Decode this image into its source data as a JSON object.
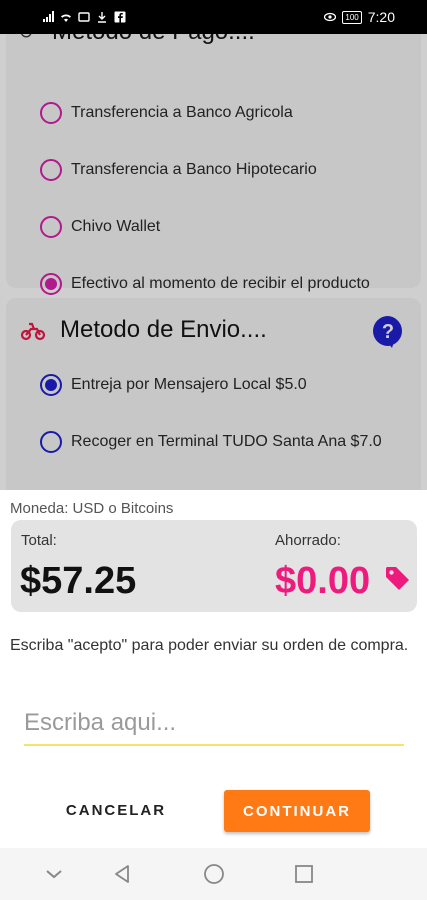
{
  "status_bar": {
    "battery": "100",
    "time": "7:20"
  },
  "payment_card": {
    "title": "Metodo de Pago....",
    "options": [
      {
        "label": "Transferencia a Banco Agricola",
        "selected": false
      },
      {
        "label": "Transferencia a Banco Hipotecario",
        "selected": false
      },
      {
        "label": "Chivo Wallet",
        "selected": false
      },
      {
        "label": "Efectivo al momento de recibir el producto",
        "selected": true
      }
    ]
  },
  "shipping_card": {
    "title": "Metodo de Envio....",
    "options": [
      {
        "label": "Entreja por Mensajero Local $5.0",
        "selected": true
      },
      {
        "label": "Recoger en Terminal TUDO Santa Ana $7.0",
        "selected": false
      }
    ]
  },
  "sheet": {
    "currency": "Moneda: USD o Bitcoins",
    "total_label": "Total:",
    "total_value": "$57.25",
    "saved_label": "Ahorrado:",
    "saved_value": "$0.00",
    "instructions": "Escriba \"acepto\" para poder enviar su orden de compra.",
    "input_value": "",
    "input_placeholder": "Escriba aqui...",
    "cancel_label": "CANCELAR",
    "continue_label": "CONTINUAR"
  },
  "colors": {
    "accent_orange": "#ff7a14",
    "saved_pink": "#ee1b7f",
    "radio_pink": "#b01a8c",
    "radio_blue": "#1a1aa8",
    "input_underline": "#f5e46a"
  },
  "icons": [
    "wifi-icon",
    "signal-icon",
    "help-icon",
    "motorcycle-icon",
    "tag-icon",
    "back-icon",
    "home-icon",
    "recents-icon",
    "nav-down-icon"
  ]
}
